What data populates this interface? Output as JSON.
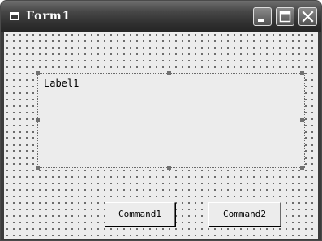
{
  "window": {
    "title": "Form1"
  },
  "titlebar_buttons": [
    {
      "name": "minimize-button",
      "icon": "minimize-icon"
    },
    {
      "name": "maximize-button",
      "icon": "maximize-icon"
    },
    {
      "name": "close-button",
      "icon": "close-icon"
    }
  ],
  "form": {
    "label": {
      "caption": "Label1"
    },
    "buttons": [
      {
        "caption": "Command1"
      },
      {
        "caption": "Command2"
      }
    ]
  },
  "colors": {
    "titlebar": "#2f2f2f",
    "client": "#ececec",
    "grid_dots": "#2a2a2a",
    "handles": "#707070"
  }
}
